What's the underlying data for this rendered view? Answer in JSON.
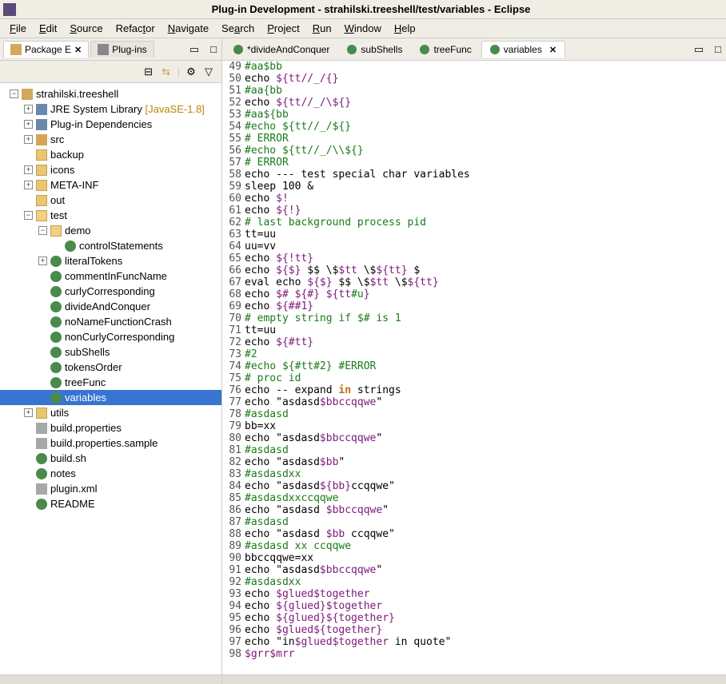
{
  "window": {
    "title": "Plug-in Development - strahilski.treeshell/test/variables - Eclipse"
  },
  "menu": [
    "File",
    "Edit",
    "Source",
    "Refactor",
    "Navigate",
    "Search",
    "Project",
    "Run",
    "Window",
    "Help"
  ],
  "leftTabs": [
    {
      "label": "Package E",
      "closable": true,
      "active": true
    },
    {
      "label": "Plug-ins",
      "closable": false,
      "active": false
    }
  ],
  "tree": [
    {
      "indent": 0,
      "exp": "-",
      "icon": "proj",
      "label": "strahilski.treeshell"
    },
    {
      "indent": 1,
      "exp": "+",
      "icon": "lib",
      "label": "JRE System Library",
      "anno": "[JavaSE-1.8]"
    },
    {
      "indent": 1,
      "exp": "+",
      "icon": "lib",
      "label": "Plug-in Dependencies"
    },
    {
      "indent": 1,
      "exp": "+",
      "icon": "pkg",
      "label": "src"
    },
    {
      "indent": 1,
      "exp": "",
      "icon": "folder",
      "label": "backup"
    },
    {
      "indent": 1,
      "exp": "+",
      "icon": "folder",
      "label": "icons"
    },
    {
      "indent": 1,
      "exp": "+",
      "icon": "folder",
      "label": "META-INF"
    },
    {
      "indent": 1,
      "exp": "",
      "icon": "folder",
      "label": "out"
    },
    {
      "indent": 1,
      "exp": "-",
      "icon": "folder-open",
      "label": "test"
    },
    {
      "indent": 2,
      "exp": "-",
      "icon": "folder-open",
      "label": "demo"
    },
    {
      "indent": 3,
      "exp": "",
      "icon": "sh",
      "label": "controlStatements"
    },
    {
      "indent": 2,
      "exp": "+",
      "icon": "sh",
      "label": "literalTokens"
    },
    {
      "indent": 2,
      "exp": "",
      "icon": "sh",
      "label": "commentInFuncName"
    },
    {
      "indent": 2,
      "exp": "",
      "icon": "sh",
      "label": "curlyCorresponding"
    },
    {
      "indent": 2,
      "exp": "",
      "icon": "sh",
      "label": "divideAndConquer"
    },
    {
      "indent": 2,
      "exp": "",
      "icon": "sh",
      "label": "noNameFunctionCrash"
    },
    {
      "indent": 2,
      "exp": "",
      "icon": "sh",
      "label": "nonCurlyCorresponding"
    },
    {
      "indent": 2,
      "exp": "",
      "icon": "sh",
      "label": "subShells"
    },
    {
      "indent": 2,
      "exp": "",
      "icon": "sh",
      "label": "tokensOrder"
    },
    {
      "indent": 2,
      "exp": "",
      "icon": "sh",
      "label": "treeFunc"
    },
    {
      "indent": 2,
      "exp": "",
      "icon": "sh",
      "label": "variables",
      "selected": true
    },
    {
      "indent": 1,
      "exp": "+",
      "icon": "folder",
      "label": "utils"
    },
    {
      "indent": 1,
      "exp": "",
      "icon": "file",
      "label": "build.properties"
    },
    {
      "indent": 1,
      "exp": "",
      "icon": "file",
      "label": "build.properties.sample"
    },
    {
      "indent": 1,
      "exp": "",
      "icon": "sh",
      "label": "build.sh"
    },
    {
      "indent": 1,
      "exp": "",
      "icon": "sh",
      "label": "notes"
    },
    {
      "indent": 1,
      "exp": "",
      "icon": "file",
      "label": "plugin.xml"
    },
    {
      "indent": 1,
      "exp": "",
      "icon": "sh",
      "label": "README"
    }
  ],
  "editorTabs": [
    {
      "label": "*divideAndConquer",
      "active": false
    },
    {
      "label": "subShells",
      "active": false
    },
    {
      "label": "treeFunc",
      "active": false
    },
    {
      "label": "variables",
      "active": true,
      "closable": true
    }
  ],
  "code": [
    {
      "n": 49,
      "spans": [
        {
          "c": "green",
          "t": "#aa$bb"
        }
      ]
    },
    {
      "n": 50,
      "spans": [
        {
          "t": "echo "
        },
        {
          "c": "purple",
          "t": "${tt//_/{}"
        }
      ]
    },
    {
      "n": 51,
      "spans": [
        {
          "c": "green",
          "t": "#aa{bb"
        }
      ]
    },
    {
      "n": 52,
      "spans": [
        {
          "t": "echo "
        },
        {
          "c": "purple",
          "t": "${tt//_/\\${}"
        }
      ]
    },
    {
      "n": 53,
      "spans": [
        {
          "c": "green",
          "t": "#aa${bb"
        }
      ]
    },
    {
      "n": 54,
      "spans": [
        {
          "c": "green",
          "t": "#echo ${tt//_/${}"
        }
      ]
    },
    {
      "n": 55,
      "spans": [
        {
          "c": "green",
          "t": "# ERROR"
        }
      ]
    },
    {
      "n": 56,
      "spans": [
        {
          "c": "green",
          "t": "#echo ${tt//_/\\\\${}"
        }
      ]
    },
    {
      "n": 57,
      "spans": [
        {
          "c": "green",
          "t": "# ERROR"
        }
      ]
    },
    {
      "n": 58,
      "spans": [
        {
          "t": "echo --- test special char variables"
        }
      ]
    },
    {
      "n": 59,
      "spans": [
        {
          "t": "sleep 100 &"
        }
      ]
    },
    {
      "n": 60,
      "spans": [
        {
          "t": "echo "
        },
        {
          "c": "purple",
          "t": "$!"
        }
      ]
    },
    {
      "n": 61,
      "spans": [
        {
          "t": "echo "
        },
        {
          "c": "purple",
          "t": "${!}"
        }
      ]
    },
    {
      "n": 62,
      "spans": [
        {
          "c": "green",
          "t": "# last background process pid"
        }
      ]
    },
    {
      "n": 63,
      "spans": [
        {
          "t": "tt=uu"
        }
      ]
    },
    {
      "n": 64,
      "spans": [
        {
          "t": "uu=vv"
        }
      ]
    },
    {
      "n": 65,
      "spans": [
        {
          "t": "echo "
        },
        {
          "c": "purple",
          "t": "${!tt}"
        }
      ]
    },
    {
      "n": 66,
      "spans": [
        {
          "t": "echo "
        },
        {
          "c": "purple",
          "t": "${$}"
        },
        {
          "t": " $$ \\$"
        },
        {
          "c": "purple",
          "t": "$tt"
        },
        {
          "t": " \\$"
        },
        {
          "c": "purple",
          "t": "${tt}"
        },
        {
          "t": " $"
        }
      ]
    },
    {
      "n": 67,
      "spans": [
        {
          "t": "eval echo "
        },
        {
          "c": "purple",
          "t": "${$}"
        },
        {
          "t": " $$ \\$"
        },
        {
          "c": "purple",
          "t": "$tt"
        },
        {
          "t": " \\$"
        },
        {
          "c": "purple",
          "t": "${tt}"
        }
      ]
    },
    {
      "n": 68,
      "spans": [
        {
          "t": "echo "
        },
        {
          "c": "purple",
          "t": "$#"
        },
        {
          "t": " "
        },
        {
          "c": "purple",
          "t": "${#}"
        },
        {
          "t": " "
        },
        {
          "c": "purple",
          "t": "${tt"
        },
        {
          "c": "green",
          "t": "#u"
        },
        {
          "c": "purple",
          "t": "}"
        }
      ]
    },
    {
      "n": 69,
      "spans": [
        {
          "t": "echo "
        },
        {
          "c": "purple",
          "t": "${##1}"
        }
      ]
    },
    {
      "n": 70,
      "spans": [
        {
          "c": "green",
          "t": "# empty string if $# is 1"
        }
      ]
    },
    {
      "n": 71,
      "spans": [
        {
          "t": "tt=uu"
        }
      ]
    },
    {
      "n": 72,
      "spans": [
        {
          "t": "echo "
        },
        {
          "c": "purple",
          "t": "${#tt}"
        }
      ]
    },
    {
      "n": 73,
      "spans": [
        {
          "c": "green",
          "t": "#2"
        }
      ]
    },
    {
      "n": 74,
      "spans": [
        {
          "c": "green",
          "t": "#echo ${#tt#2} #ERROR"
        }
      ]
    },
    {
      "n": 75,
      "spans": [
        {
          "c": "green",
          "t": "# proc id"
        }
      ]
    },
    {
      "n": 76,
      "spans": [
        {
          "t": "echo -- expand "
        },
        {
          "c": "orange",
          "t": "in"
        },
        {
          "t": " strings"
        }
      ]
    },
    {
      "n": 77,
      "spans": [
        {
          "t": "echo \"asdasd"
        },
        {
          "c": "purple",
          "t": "$bbccqqwe"
        },
        {
          "t": "\""
        }
      ]
    },
    {
      "n": 78,
      "spans": [
        {
          "c": "green",
          "t": "#asdasd"
        }
      ]
    },
    {
      "n": 79,
      "spans": [
        {
          "t": "bb=xx"
        }
      ]
    },
    {
      "n": 80,
      "spans": [
        {
          "t": "echo \"asdasd"
        },
        {
          "c": "purple",
          "t": "$bbccqqwe"
        },
        {
          "t": "\""
        }
      ]
    },
    {
      "n": 81,
      "spans": [
        {
          "c": "green",
          "t": "#asdasd"
        }
      ]
    },
    {
      "n": 82,
      "spans": [
        {
          "t": "echo \"asdasd"
        },
        {
          "c": "purple",
          "t": "$bb"
        },
        {
          "t": "\""
        }
      ]
    },
    {
      "n": 83,
      "spans": [
        {
          "c": "green",
          "t": "#asdasdxx"
        }
      ]
    },
    {
      "n": 84,
      "spans": [
        {
          "t": "echo \"asdasd"
        },
        {
          "c": "purple",
          "t": "${bb}"
        },
        {
          "t": "ccqqwe\""
        }
      ]
    },
    {
      "n": 85,
      "spans": [
        {
          "c": "green",
          "t": "#asdasdxxccqqwe"
        }
      ]
    },
    {
      "n": 86,
      "spans": [
        {
          "t": "echo \"asdasd "
        },
        {
          "c": "purple",
          "t": "$bbccqqwe"
        },
        {
          "t": "\""
        }
      ]
    },
    {
      "n": 87,
      "spans": [
        {
          "c": "green",
          "t": "#asdasd"
        }
      ]
    },
    {
      "n": 88,
      "spans": [
        {
          "t": "echo \"asdasd "
        },
        {
          "c": "purple",
          "t": "$bb"
        },
        {
          "t": " ccqqwe\""
        }
      ]
    },
    {
      "n": 89,
      "spans": [
        {
          "c": "green",
          "t": "#asdasd xx ccqqwe"
        }
      ]
    },
    {
      "n": 90,
      "spans": [
        {
          "t": "bbccqqwe=xx"
        }
      ]
    },
    {
      "n": 91,
      "spans": [
        {
          "t": "echo \"asdasd"
        },
        {
          "c": "purple",
          "t": "$bbccqqwe"
        },
        {
          "t": "\""
        }
      ]
    },
    {
      "n": 92,
      "spans": [
        {
          "c": "green",
          "t": "#asdasdxx"
        }
      ]
    },
    {
      "n": 93,
      "spans": [
        {
          "t": "echo "
        },
        {
          "c": "purple",
          "t": "$glued$together"
        }
      ]
    },
    {
      "n": 94,
      "spans": [
        {
          "t": "echo "
        },
        {
          "c": "purple",
          "t": "${glued}$together"
        }
      ]
    },
    {
      "n": 95,
      "spans": [
        {
          "t": "echo "
        },
        {
          "c": "purple",
          "t": "${glued}${together}"
        }
      ]
    },
    {
      "n": 96,
      "spans": [
        {
          "t": "echo "
        },
        {
          "c": "purple",
          "t": "$glued${together}"
        }
      ]
    },
    {
      "n": 97,
      "spans": [
        {
          "t": "echo \"in"
        },
        {
          "c": "purple",
          "t": "$glued$together"
        },
        {
          "t": " in quote\""
        }
      ]
    },
    {
      "n": 98,
      "spans": [
        {
          "c": "purple",
          "t": "$grr$mrr"
        }
      ]
    }
  ]
}
